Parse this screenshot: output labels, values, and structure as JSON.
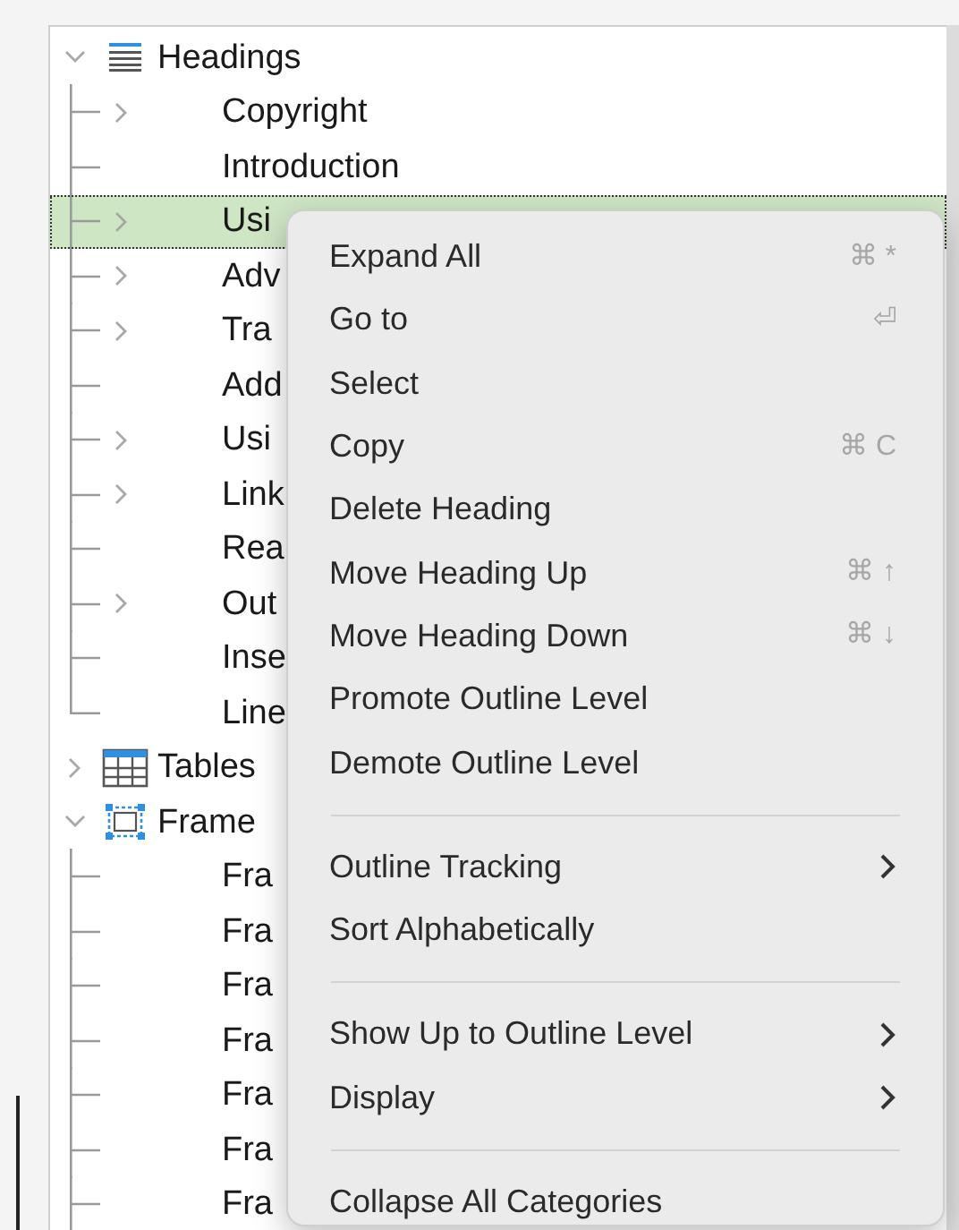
{
  "navigator": {
    "categories": [
      {
        "label": "Headings",
        "expanded": true,
        "children": [
          {
            "label": "Copyright",
            "expandable": true,
            "selected": false
          },
          {
            "label": "Introduction",
            "expandable": false,
            "selected": false
          },
          {
            "label": "Usi",
            "expandable": true,
            "selected": true
          },
          {
            "label": "Adv",
            "expandable": true,
            "selected": false
          },
          {
            "label": "Tra",
            "expandable": true,
            "selected": false
          },
          {
            "label": "Add",
            "expandable": false,
            "selected": false
          },
          {
            "label": "Usi",
            "expandable": true,
            "selected": false
          },
          {
            "label": "Link",
            "expandable": true,
            "selected": false
          },
          {
            "label": "Rea",
            "expandable": false,
            "selected": false
          },
          {
            "label": "Out",
            "expandable": true,
            "selected": false
          },
          {
            "label": "Inse",
            "expandable": false,
            "selected": false
          },
          {
            "label": "Line",
            "expandable": false,
            "selected": false
          }
        ]
      },
      {
        "label": "Tables",
        "expanded": false
      },
      {
        "label": "Frame",
        "expanded": true,
        "children": [
          {
            "label": "Fra",
            "expandable": false,
            "selected": false
          },
          {
            "label": "Fra",
            "expandable": false,
            "selected": false
          },
          {
            "label": "Fra",
            "expandable": false,
            "selected": false
          },
          {
            "label": "Fra",
            "expandable": false,
            "selected": false
          },
          {
            "label": "Fra",
            "expandable": false,
            "selected": false
          },
          {
            "label": "Fra",
            "expandable": false,
            "selected": false
          },
          {
            "label": "Fra",
            "expandable": false,
            "selected": false
          }
        ]
      }
    ]
  },
  "context_menu": {
    "items": [
      {
        "kind": "command",
        "label": "Expand All",
        "shortcut": "⌘ *"
      },
      {
        "kind": "command",
        "label": "Go to",
        "shortcut": "⏎"
      },
      {
        "kind": "command",
        "label": "Select"
      },
      {
        "kind": "command",
        "label": "Copy",
        "shortcut": "⌘ C"
      },
      {
        "kind": "command",
        "label": "Delete Heading"
      },
      {
        "kind": "command",
        "label": "Move Heading Up",
        "shortcut": "⌘ ↑"
      },
      {
        "kind": "command",
        "label": "Move Heading Down",
        "shortcut": "⌘ ↓"
      },
      {
        "kind": "command",
        "label": "Promote Outline Level"
      },
      {
        "kind": "command",
        "label": "Demote Outline Level"
      },
      {
        "kind": "separator"
      },
      {
        "kind": "submenu",
        "label": "Outline Tracking"
      },
      {
        "kind": "command",
        "label": "Sort Alphabetically"
      },
      {
        "kind": "separator"
      },
      {
        "kind": "submenu",
        "label": "Show Up to Outline Level"
      },
      {
        "kind": "submenu",
        "label": "Display"
      },
      {
        "kind": "separator"
      },
      {
        "kind": "command",
        "label": "Collapse All Categories"
      }
    ]
  }
}
